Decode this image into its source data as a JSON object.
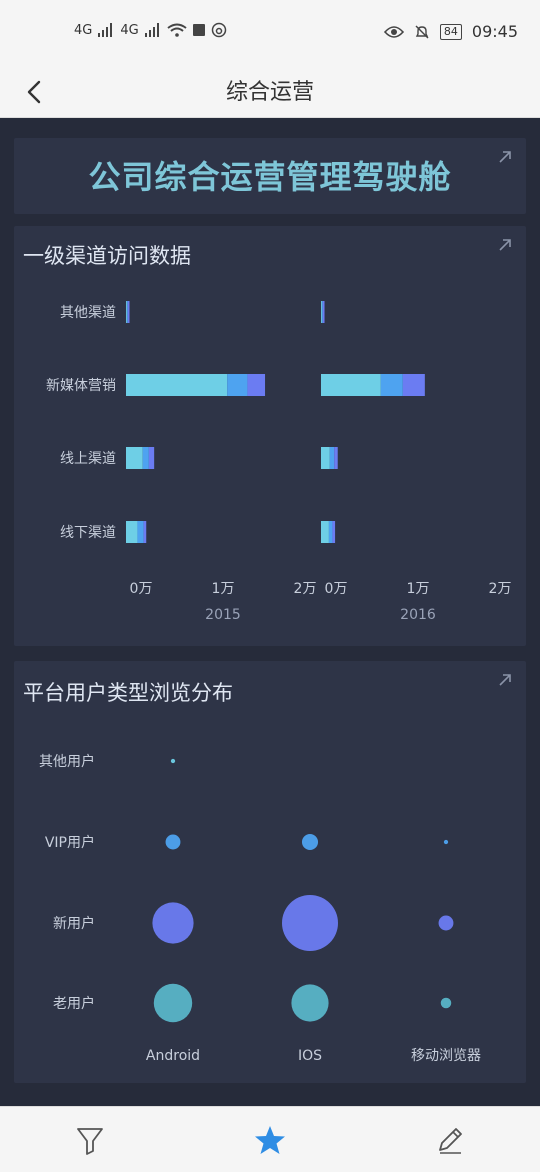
{
  "status": {
    "signal1": "4G",
    "signal2": "4G",
    "battery": "84",
    "time": "09:45"
  },
  "nav": {
    "title": "综合运营",
    "back_icon": "chevron-left-icon"
  },
  "hero": {
    "title": "公司综合运营管理驾驶舱"
  },
  "channel_card": {
    "title": "一级渠道访问数据"
  },
  "user_card": {
    "title": "平台用户类型浏览分布"
  },
  "colors": {
    "bg": "#262b3a",
    "card": "#2e3447",
    "seg1": "#6ecfe6",
    "seg2": "#4ea3f0",
    "seg3": "#6b7cf2",
    "bubble_blue": "#4ea3f0",
    "bubble_purple": "#6b7cf2",
    "bubble_teal": "#59b5c8"
  },
  "chart_data": [
    {
      "type": "bar",
      "orientation": "horizontal-stacked",
      "categories": [
        "其他渠道",
        "新媒体营销",
        "线上渠道",
        "线下渠道"
      ],
      "panels": [
        {
          "label": "2015",
          "series": [
            {
              "values": [
                100,
                11500,
                1900,
                1300
              ]
            },
            {
              "values": [
                100,
                2300,
                700,
                700
              ]
            },
            {
              "values": [
                200,
                2000,
                600,
                300
              ]
            }
          ]
        },
        {
          "label": "2016",
          "series": [
            {
              "values": [
                100,
                6800,
                1000,
                900
              ]
            },
            {
              "values": [
                100,
                2500,
                500,
                400
              ]
            },
            {
              "values": [
                200,
                2500,
                400,
                300
              ]
            }
          ]
        }
      ],
      "xlim": [
        0,
        20000
      ],
      "xticks": [
        "0万",
        "1万",
        "2万"
      ]
    },
    {
      "type": "scatter",
      "subtype": "bubble",
      "x_categories": [
        "Android",
        "IOS",
        "移动浏览器"
      ],
      "y_categories": [
        "其他用户",
        "VIP用户",
        "新用户",
        "老用户"
      ],
      "points": [
        {
          "x": "Android",
          "y": "其他用户",
          "value": 1
        },
        {
          "x": "Android",
          "y": "VIP用户",
          "value": 12
        },
        {
          "x": "IOS",
          "y": "VIP用户",
          "value": 14
        },
        {
          "x": "移动浏览器",
          "y": "VIP用户",
          "value": 1
        },
        {
          "x": "Android",
          "y": "新用户",
          "value": 92
        },
        {
          "x": "IOS",
          "y": "新用户",
          "value": 170
        },
        {
          "x": "移动浏览器",
          "y": "新用户",
          "value": 12
        },
        {
          "x": "Android",
          "y": "老用户",
          "value": 80
        },
        {
          "x": "IOS",
          "y": "老用户",
          "value": 75
        },
        {
          "x": "移动浏览器",
          "y": "老用户",
          "value": 6
        }
      ]
    }
  ],
  "tabs": [
    {
      "icon": "filter-icon"
    },
    {
      "icon": "star-icon"
    },
    {
      "icon": "pencil-icon"
    }
  ]
}
